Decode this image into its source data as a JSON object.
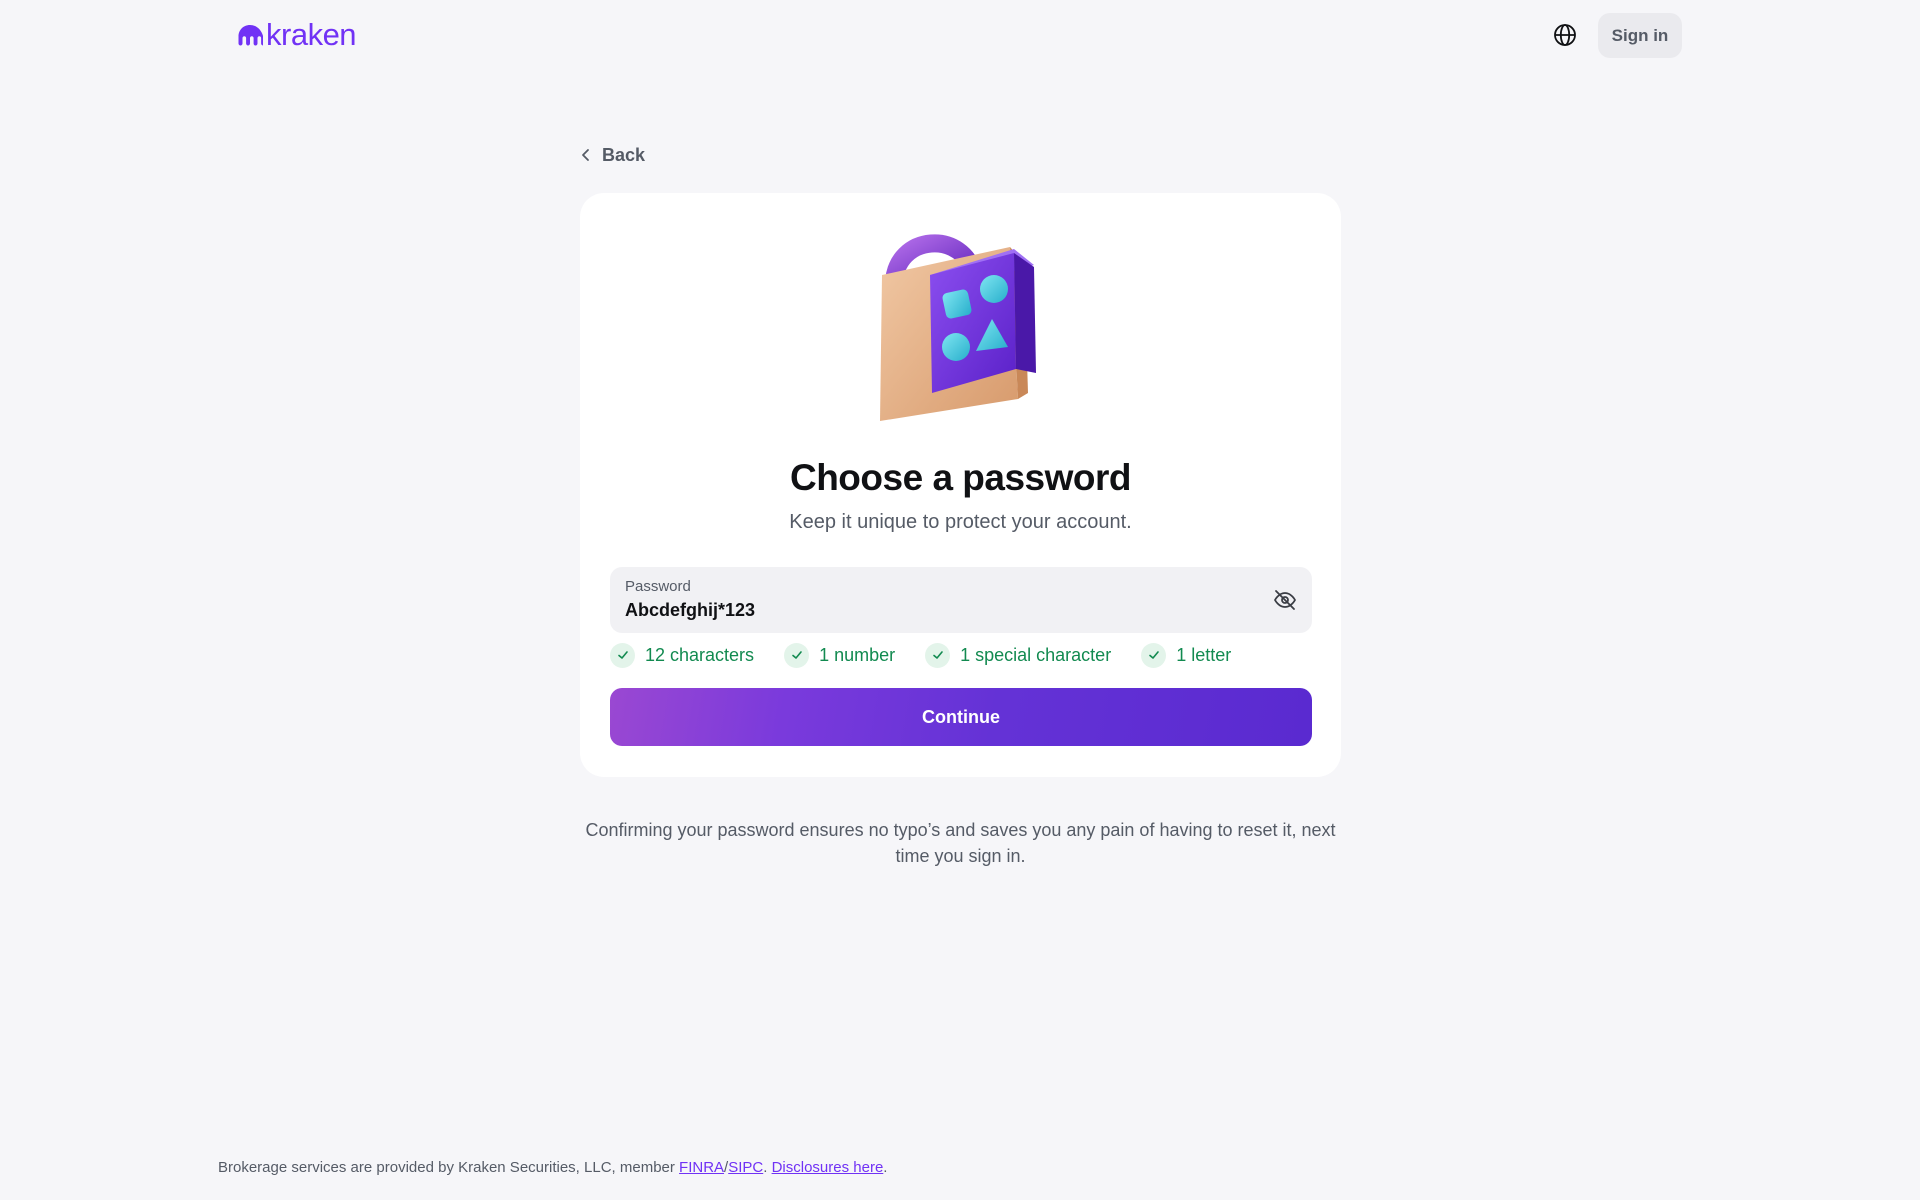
{
  "header": {
    "logo_text": "kraken",
    "globe_icon": "globe-icon",
    "signin_label": "Sign in"
  },
  "back": {
    "label": "Back",
    "icon": "chevron-left-icon"
  },
  "card": {
    "illustration": "padlock-illustration",
    "title": "Choose a password",
    "subtitle": "Keep it unique to protect your account.",
    "password_field": {
      "label": "Password",
      "value": "Abcdefghij*123",
      "toggle_icon": "eye-off-icon"
    },
    "requirements": [
      {
        "label": "12 characters",
        "met": true
      },
      {
        "label": "1 number",
        "met": true
      },
      {
        "label": "1 special character",
        "met": true
      },
      {
        "label": "1 letter",
        "met": true
      }
    ],
    "continue_label": "Continue"
  },
  "note": "Confirming your password ensures no typo’s and saves you any pain of having to reset it, next time you sign in.",
  "footer": {
    "text_before": "Brokerage services are provided by Kraken Securities, LLC, member ",
    "finra_link": "FINRA",
    "separator": "/",
    "sipc_link": "SIPC",
    "text_middle": ". ",
    "disclosures_link": "Disclosures here",
    "text_end": "."
  },
  "colors": {
    "brand": "#7132f5",
    "background": "#f6f6f9",
    "success": "#128a50",
    "button_gradient_start": "#9a48d2",
    "button_gradient_end": "#5a2ad0"
  }
}
